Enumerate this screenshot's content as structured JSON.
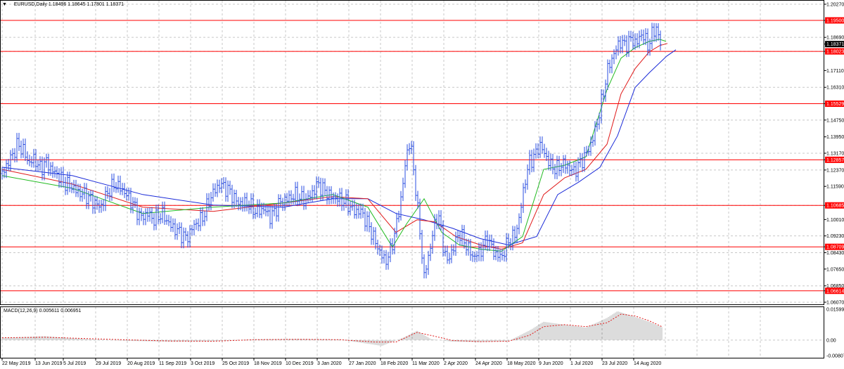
{
  "symbol_info": {
    "symbol": "EURUSD,Daily",
    "open": "1.18496",
    "high": "1.18645",
    "low": "1.17801",
    "close": "1.18371",
    "toggle_icon": "triangle-down-icon"
  },
  "macd_info": {
    "label": "MACD(12,26,9)",
    "main": "0.005611",
    "signal": "0.006951"
  },
  "colors": {
    "price": "#2a4de0",
    "ma_fast": "#22bb22",
    "ma_mid": "#e01a1a",
    "ma_slow": "#1a2ad8",
    "level": "#ff0000",
    "grid": "#c8c8c8",
    "macd_hist": "#b8b8b8",
    "macd_signal": "#e01a1a"
  },
  "price_axis": {
    "min": 1.0607,
    "max": 1.2027,
    "ticks": [
      "1.20270",
      "1.19500",
      "1.18690",
      "1.18371",
      "1.18023",
      "1.17110",
      "1.16310",
      "1.15529",
      "1.14750",
      "1.13950",
      "1.13170",
      "1.12857",
      "1.12370",
      "1.11590",
      "1.10685",
      "1.10010",
      "1.09230",
      "1.08709",
      "1.08430",
      "1.07650",
      "1.06850",
      "1.06614",
      "1.06070"
    ],
    "current_price_label": "1.18371"
  },
  "levels": [
    {
      "price": 1.195,
      "label": "1.19500"
    },
    {
      "price": 1.18023,
      "label": "1.18023"
    },
    {
      "price": 1.15529,
      "label": "1.15529"
    },
    {
      "price": 1.12857,
      "label": "1.12857"
    },
    {
      "price": 1.10685,
      "label": "1.10685"
    },
    {
      "price": 1.08709,
      "label": "1.08709"
    },
    {
      "price": 1.06614,
      "label": "1.06614"
    }
  ],
  "macd_axis": {
    "ticks": [
      "0.015999",
      "0.00",
      "-0.008070"
    ],
    "min": -0.00807,
    "max": 0.015999
  },
  "time_axis": {
    "labels": [
      "22 May 2019",
      "13 Jun 2019",
      "5 Jul 2019",
      "29 Jul 2019",
      "20 Aug 2019",
      "11 Sep 2019",
      "3 Oct 2019",
      "25 Oct 2019",
      "18 Nov 2019",
      "10 Dec 2019",
      "3 Jan 2020",
      "27 Jan 2020",
      "18 Feb 2020",
      "11 Mar 2020",
      "2 Apr 2020",
      "24 Apr 2020",
      "18 May 2020",
      "9 Jun 2020",
      "1 Jul 2020",
      "23 Jul 2020",
      "14 Aug 2020"
    ]
  },
  "chart_data": {
    "type": "line",
    "title": "EURUSD,Daily",
    "x": [
      "22 May 2019",
      "13 Jun 2019",
      "5 Jul 2019",
      "29 Jul 2019",
      "20 Aug 2019",
      "11 Sep 2019",
      "3 Oct 2019",
      "25 Oct 2019",
      "18 Nov 2019",
      "10 Dec 2019",
      "3 Jan 2020",
      "27 Jan 2020",
      "18 Feb 2020",
      "11 Mar 2020",
      "2 Apr 2020",
      "24 Apr 2020",
      "18 May 2020",
      "9 Jun 2020",
      "1 Jul 2020",
      "23 Jul 2020",
      "14 Aug 2020"
    ],
    "price_keypoints": [
      [
        0,
        1.122
      ],
      [
        8,
        1.127
      ],
      [
        15,
        1.131
      ],
      [
        22,
        1.136
      ],
      [
        30,
        1.133
      ],
      [
        38,
        1.127
      ],
      [
        46,
        1.129
      ],
      [
        55,
        1.124
      ],
      [
        62,
        1.128
      ],
      [
        70,
        1.124
      ],
      [
        80,
        1.121
      ],
      [
        90,
        1.117
      ],
      [
        98,
        1.116
      ],
      [
        108,
        1.113
      ],
      [
        118,
        1.112
      ],
      [
        128,
        1.109
      ],
      [
        140,
        1.106
      ],
      [
        150,
        1.113
      ],
      [
        160,
        1.117
      ],
      [
        172,
        1.114
      ],
      [
        185,
        1.108
      ],
      [
        197,
        1.101
      ],
      [
        207,
        1.103
      ],
      [
        216,
        1.1
      ],
      [
        227,
        1.103
      ],
      [
        240,
        1.097
      ],
      [
        252,
        1.094
      ],
      [
        262,
        1.091
      ],
      [
        272,
        1.097
      ],
      [
        285,
        1.101
      ],
      [
        298,
        1.112
      ],
      [
        310,
        1.117
      ],
      [
        322,
        1.114
      ],
      [
        335,
        1.108
      ],
      [
        348,
        1.108
      ],
      [
        360,
        1.104
      ],
      [
        372,
        1.105
      ],
      [
        382,
        1.101
      ],
      [
        394,
        1.108
      ],
      [
        406,
        1.11
      ],
      [
        418,
        1.112
      ],
      [
        430,
        1.109
      ],
      [
        440,
        1.112
      ],
      [
        448,
        1.117
      ],
      [
        458,
        1.114
      ],
      [
        468,
        1.111
      ],
      [
        478,
        1.11
      ],
      [
        490,
        1.108
      ],
      [
        500,
        1.104
      ],
      [
        510,
        1.104
      ],
      [
        520,
        1.098
      ],
      [
        530,
        1.09
      ],
      [
        538,
        1.084
      ],
      [
        545,
        1.08
      ],
      [
        552,
        1.085
      ],
      [
        560,
        1.096
      ],
      [
        568,
        1.112
      ],
      [
        575,
        1.131
      ],
      [
        580,
        1.138
      ],
      [
        588,
        1.115
      ],
      [
        594,
        1.094
      ],
      [
        600,
        1.073
      ],
      [
        606,
        1.082
      ],
      [
        612,
        1.093
      ],
      [
        620,
        1.104
      ],
      [
        626,
        1.089
      ],
      [
        633,
        1.08
      ],
      [
        642,
        1.087
      ],
      [
        650,
        1.094
      ],
      [
        660,
        1.088
      ],
      [
        670,
        1.082
      ],
      [
        680,
        1.085
      ],
      [
        690,
        1.091
      ],
      [
        700,
        1.084
      ],
      [
        710,
        1.082
      ],
      [
        720,
        1.09
      ],
      [
        728,
        1.092
      ],
      [
        735,
        1.1
      ],
      [
        742,
        1.116
      ],
      [
        750,
        1.128
      ],
      [
        757,
        1.13
      ],
      [
        764,
        1.136
      ],
      [
        772,
        1.131
      ],
      [
        780,
        1.126
      ],
      [
        788,
        1.124
      ],
      [
        797,
        1.127
      ],
      [
        805,
        1.125
      ],
      [
        813,
        1.123
      ],
      [
        820,
        1.126
      ],
      [
        828,
        1.13
      ],
      [
        836,
        1.135
      ],
      [
        842,
        1.141
      ],
      [
        848,
        1.149
      ],
      [
        855,
        1.161
      ],
      [
        862,
        1.173
      ],
      [
        870,
        1.179
      ],
      [
        878,
        1.185
      ],
      [
        886,
        1.183
      ],
      [
        894,
        1.186
      ],
      [
        902,
        1.184
      ],
      [
        910,
        1.189
      ],
      [
        918,
        1.183
      ],
      [
        924,
        1.188
      ],
      [
        930,
        1.192
      ],
      [
        934,
        1.185
      ],
      [
        938,
        1.184
      ]
    ],
    "ma_fast_keypoints": [
      [
        0,
        1.121
      ],
      [
        100,
        1.115
      ],
      [
        200,
        1.103
      ],
      [
        300,
        1.106
      ],
      [
        400,
        1.108
      ],
      [
        470,
        1.112
      ],
      [
        520,
        1.106
      ],
      [
        555,
        1.087
      ],
      [
        575,
        1.098
      ],
      [
        600,
        1.11
      ],
      [
        625,
        1.094
      ],
      [
        650,
        1.088
      ],
      [
        680,
        1.086
      ],
      [
        710,
        1.085
      ],
      [
        740,
        1.092
      ],
      [
        770,
        1.124
      ],
      [
        800,
        1.126
      ],
      [
        830,
        1.13
      ],
      [
        860,
        1.162
      ],
      [
        880,
        1.177
      ],
      [
        900,
        1.182
      ],
      [
        920,
        1.185
      ],
      [
        935,
        1.186
      ],
      [
        944,
        1.185
      ]
    ],
    "ma_mid_keypoints": [
      [
        0,
        1.124
      ],
      [
        100,
        1.117
      ],
      [
        200,
        1.106
      ],
      [
        300,
        1.104
      ],
      [
        400,
        1.108
      ],
      [
        470,
        1.111
      ],
      [
        520,
        1.11
      ],
      [
        560,
        1.094
      ],
      [
        590,
        1.1
      ],
      [
        615,
        1.099
      ],
      [
        645,
        1.092
      ],
      [
        680,
        1.088
      ],
      [
        710,
        1.086
      ],
      [
        740,
        1.089
      ],
      [
        770,
        1.112
      ],
      [
        800,
        1.12
      ],
      [
        830,
        1.124
      ],
      [
        860,
        1.136
      ],
      [
        880,
        1.16
      ],
      [
        900,
        1.172
      ],
      [
        920,
        1.18
      ],
      [
        935,
        1.183
      ],
      [
        946,
        1.184
      ]
    ],
    "ma_slow_keypoints": [
      [
        0,
        1.125
      ],
      [
        100,
        1.121
      ],
      [
        200,
        1.112
      ],
      [
        300,
        1.107
      ],
      [
        400,
        1.106
      ],
      [
        470,
        1.11
      ],
      [
        520,
        1.11
      ],
      [
        560,
        1.103
      ],
      [
        600,
        1.1
      ],
      [
        640,
        1.096
      ],
      [
        680,
        1.091
      ],
      [
        720,
        1.088
      ],
      [
        760,
        1.092
      ],
      [
        790,
        1.112
      ],
      [
        820,
        1.118
      ],
      [
        850,
        1.125
      ],
      [
        875,
        1.14
      ],
      [
        900,
        1.163
      ],
      [
        920,
        1.17
      ],
      [
        945,
        1.178
      ],
      [
        958,
        1.181
      ]
    ],
    "macd_keypoints": [
      [
        0,
        0.0012
      ],
      [
        60,
        0.002
      ],
      [
        120,
        0.0005
      ],
      [
        180,
        -0.0004
      ],
      [
        240,
        -0.0008
      ],
      [
        300,
        -0.0006
      ],
      [
        360,
        0.0004
      ],
      [
        420,
        0.0006
      ],
      [
        480,
        0.0003
      ],
      [
        540,
        -0.003
      ],
      [
        570,
        0.0012
      ],
      [
        590,
        0.0048
      ],
      [
        610,
        0.0005
      ],
      [
        640,
        -0.0008
      ],
      [
        680,
        -0.001
      ],
      [
        720,
        -0.0005
      ],
      [
        750,
        0.005
      ],
      [
        770,
        0.0095
      ],
      [
        800,
        0.008
      ],
      [
        830,
        0.0065
      ],
      [
        860,
        0.0115
      ],
      [
        875,
        0.015
      ],
      [
        900,
        0.012
      ],
      [
        920,
        0.0095
      ],
      [
        938,
        0.0067
      ]
    ],
    "signal_keypoints": [
      [
        0,
        0.0012
      ],
      [
        60,
        0.0015
      ],
      [
        120,
        0.0008
      ],
      [
        180,
        0.0001
      ],
      [
        240,
        -0.0005
      ],
      [
        300,
        -0.0006
      ],
      [
        360,
        0.0002
      ],
      [
        420,
        0.0004
      ],
      [
        480,
        0.0002
      ],
      [
        530,
        -0.001
      ],
      [
        560,
        -0.001
      ],
      [
        590,
        0.004
      ],
      [
        615,
        0.002
      ],
      [
        640,
        -0.0002
      ],
      [
        680,
        -0.0008
      ],
      [
        720,
        -0.0006
      ],
      [
        750,
        0.0025
      ],
      [
        770,
        0.007
      ],
      [
        800,
        0.008
      ],
      [
        830,
        0.007
      ],
      [
        860,
        0.009
      ],
      [
        880,
        0.0135
      ],
      [
        900,
        0.0125
      ],
      [
        920,
        0.01
      ],
      [
        938,
        0.007
      ]
    ],
    "xlabel": "",
    "ylabel": "",
    "ylim": [
      1.0607,
      1.2027
    ],
    "grid": true
  }
}
